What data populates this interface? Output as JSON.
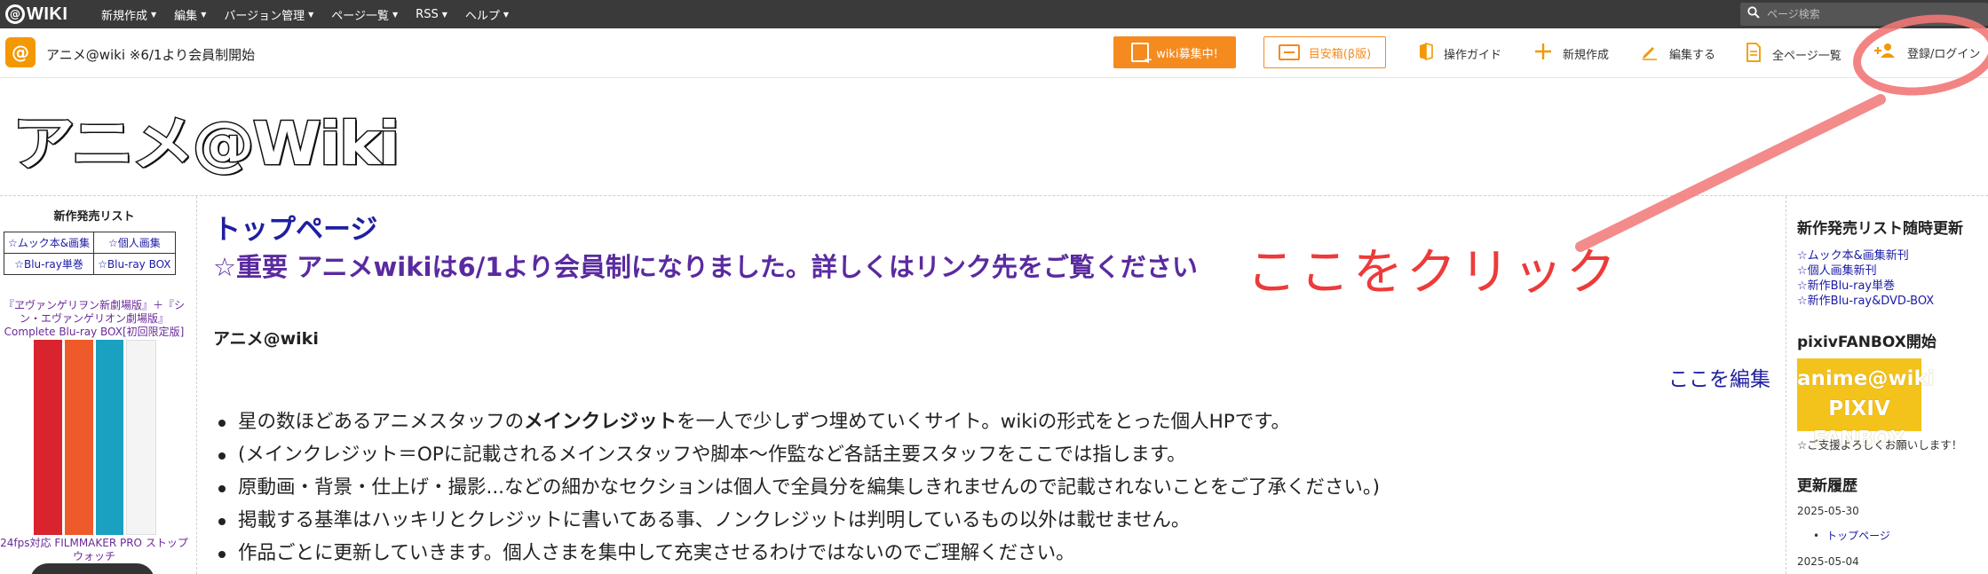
{
  "topbar": {
    "logo_text": "WIKI",
    "logo_mark": "@",
    "menus": [
      "新規作成",
      "編集",
      "バージョン管理",
      "ページ一覧",
      "RSS",
      "ヘルプ"
    ],
    "search_placeholder": "ページ検索"
  },
  "header": {
    "site_mark": "@",
    "site_title": "アニメ@wiki ※6/1より会員制開始",
    "recruit_button": "wiki募集中!",
    "meyasu_button": "目安箱(β版)",
    "nav": {
      "guide": "操作ガイド",
      "new": "新規作成",
      "edit": "編集する",
      "all_pages": "全ページ一覧",
      "login": "登録/ログイン"
    }
  },
  "wiki_logo": {
    "part1": "アニメ",
    "part2": "@Wiki"
  },
  "left_sidebar": {
    "title": "新作発売リスト",
    "table": [
      [
        "☆ムック本&画集",
        "☆個人画集"
      ],
      [
        "☆Blu-ray単巻",
        "☆Blu-ray BOX"
      ]
    ],
    "promo_title": "『ヱヴァンゲリヲン新劇場版』＋『シン・エヴァンゲリオン劇場版』Complete Blu-ray BOX[初回限定版]",
    "product2": "24fps対応 FILMMAKER PRO ストップウォッチ",
    "art_colors": [
      "#d9232e",
      "#ef5a2a",
      "#1aa0c0",
      "#f4f4f4"
    ]
  },
  "main": {
    "page_title": "トップページ",
    "notice": "☆重要 アニメwikiは6/1より会員制になりました。詳しくはリンク先をご覧ください",
    "annotation": "ここをクリック",
    "section_heading": "アニメ@wiki",
    "edit_link": "ここを編集",
    "bullets": [
      {
        "pre": "星の数ほどあるアニメスタッフの",
        "bold": "メインクレジット",
        "post": "を一人で少しずつ埋めていくサイト。wikiの形式をとった個人HPです。"
      },
      {
        "pre": "(メインクレジット＝OPに記載されるメインスタッフや脚本〜作監など各話主要スタッフをここでは指します。",
        "bold": "",
        "post": ""
      },
      {
        "pre": "原動画・背景・仕上げ・撮影...などの細かなセクションは個人で全員分を編集しきれませんので記載されないことをご了承ください。)",
        "bold": "",
        "post": ""
      },
      {
        "pre": "掲載する基準はハッキリとクレジットに書いてある事、ノンクレジットは判明しているもの以外は載せません。",
        "bold": "",
        "post": ""
      },
      {
        "pre": "作品ごとに更新していきます。個人さまを集中して充実させるわけではないのでご理解ください。",
        "bold": "",
        "post": ""
      }
    ]
  },
  "right_sidebar": {
    "list_head": "新作発売リスト随時更新",
    "list_links": [
      "☆ムック本&画集新刊",
      "☆個人画集新刊",
      "☆新作Blu-ray単巻",
      "☆新作Blu-ray&DVD-BOX"
    ],
    "fanbox_head": "pixivFANBOX開始",
    "fanbox_line1": "anime@wiki",
    "fanbox_line2": "PIXIV FANBOX",
    "fanbox_caption": "☆ご支援よろしくお願いします！",
    "history_head": "更新履歴",
    "history": [
      {
        "date": "2025-05-30",
        "item": "トップページ"
      },
      {
        "date": "2025-05-04",
        "item": ""
      }
    ]
  },
  "colors": {
    "accent": "#f39800",
    "annotation": "#ee3a3a",
    "link": "#1f1fa0"
  }
}
